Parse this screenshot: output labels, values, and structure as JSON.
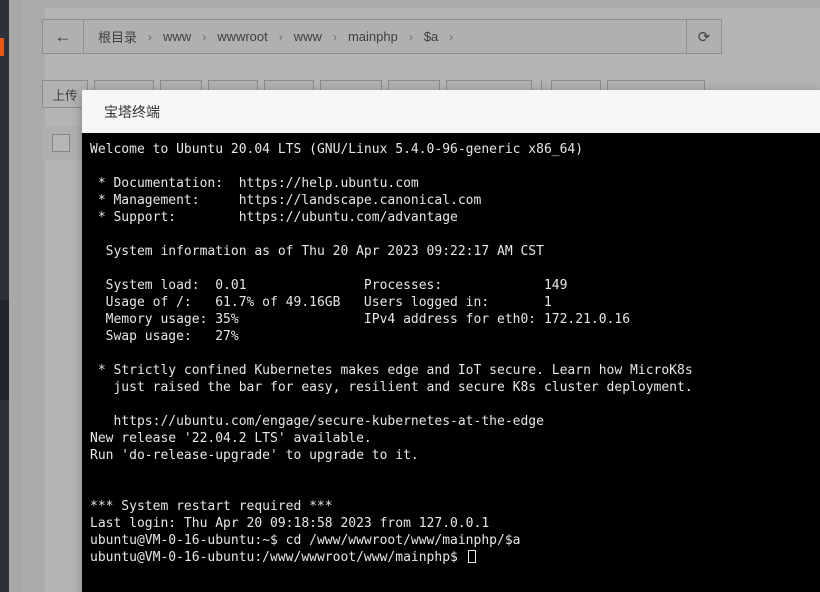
{
  "app": {
    "background_color": "#a8a8a8",
    "rail_color": "#2b3039",
    "rail_accent_color": "#e8590c"
  },
  "breadcrumb": {
    "back_icon": "←",
    "refresh_icon": "⟳",
    "separator": "›",
    "items": [
      {
        "label": "根目录"
      },
      {
        "label": "www"
      },
      {
        "label": "wwwroot"
      },
      {
        "label": "www"
      },
      {
        "label": "mainphp"
      },
      {
        "label": "$a"
      }
    ]
  },
  "toolbar": {
    "buttons": [
      {
        "label": "上传",
        "width": 46
      },
      {
        "label": "",
        "width": 60
      },
      {
        "label": "",
        "width": 42
      },
      {
        "label": "",
        "width": 50
      },
      {
        "label": "",
        "width": 50
      },
      {
        "label": "",
        "width": 62
      },
      {
        "label": "",
        "width": 52
      },
      {
        "label": "",
        "width": 86
      },
      {
        "label": "",
        "width": 50
      },
      {
        "label": "",
        "width": 98
      }
    ]
  },
  "file_table": {
    "select_all_checked": false
  },
  "terminal_dialog": {
    "title": "宝塔终端",
    "cursor": "block",
    "lines": [
      "Welcome to Ubuntu 20.04 LTS (GNU/Linux 5.4.0-96-generic x86_64)",
      "",
      " * Documentation:  https://help.ubuntu.com",
      " * Management:     https://landscape.canonical.com",
      " * Support:        https://ubuntu.com/advantage",
      "",
      "  System information as of Thu 20 Apr 2023 09:22:17 AM CST",
      "",
      "  System load:  0.01               Processes:             149",
      "  Usage of /:   61.7% of 49.16GB   Users logged in:       1",
      "  Memory usage: 35%                IPv4 address for eth0: 172.21.0.16",
      "  Swap usage:   27%",
      "",
      " * Strictly confined Kubernetes makes edge and IoT secure. Learn how MicroK8s",
      "   just raised the bar for easy, resilient and secure K8s cluster deployment.",
      "",
      "   https://ubuntu.com/engage/secure-kubernetes-at-the-edge",
      "New release '22.04.2 LTS' available.",
      "Run 'do-release-upgrade' to upgrade to it.",
      "",
      "",
      "*** System restart required ***",
      "Last login: Thu Apr 20 09:18:58 2023 from 127.0.0.1",
      "ubuntu@VM-0-16-ubuntu:~$ cd /www/wwwroot/www/mainphp/$a"
    ],
    "prompt_line": "ubuntu@VM-0-16-ubuntu:/www/wwwroot/www/mainphp$ "
  }
}
